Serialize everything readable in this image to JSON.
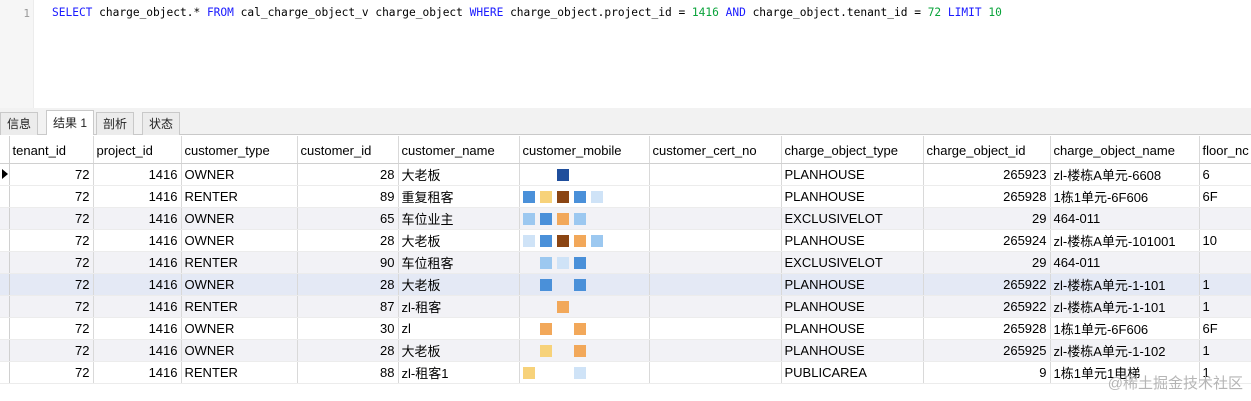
{
  "editor": {
    "line_number": "1",
    "sql_parts": {
      "select": "SELECT",
      "cols": " charge_object.* ",
      "from": "FROM",
      "table": " cal_charge_object_v charge_object ",
      "where": "WHERE",
      "cond1": " charge_object.project_id = ",
      "val1": "1416",
      "and": " AND",
      "cond2": " charge_object.tenant_id = ",
      "val2": "72",
      "limit": " LIMIT ",
      "val3": "10"
    }
  },
  "tabs": [
    {
      "label": "信息"
    },
    {
      "label": "结果 1"
    },
    {
      "label": "剖析"
    },
    {
      "label": "状态"
    }
  ],
  "columns": [
    "tenant_id",
    "project_id",
    "customer_type",
    "customer_id",
    "customer_name",
    "customer_mobile",
    "customer_cert_no",
    "charge_object_type",
    "charge_object_id",
    "charge_object_name",
    "floor_nc"
  ],
  "rows": [
    {
      "tenant_id": "72",
      "project_id": "1416",
      "customer_type": "OWNER",
      "customer_id": "28",
      "customer_name": "大老板",
      "charge_object_type": "PLANHOUSE",
      "charge_object_id": "265923",
      "charge_object_name": "zl-楼栋A单元-6608",
      "floor_no": "6"
    },
    {
      "tenant_id": "72",
      "project_id": "1416",
      "customer_type": "RENTER",
      "customer_id": "89",
      "customer_name": "重复租客",
      "charge_object_type": "PLANHOUSE",
      "charge_object_id": "265928",
      "charge_object_name": "1栋1单元-6F606",
      "floor_no": "6F"
    },
    {
      "tenant_id": "72",
      "project_id": "1416",
      "customer_type": "OWNER",
      "customer_id": "65",
      "customer_name": "车位业主",
      "charge_object_type": "EXCLUSIVELOT",
      "charge_object_id": "29",
      "charge_object_name": "464-011",
      "floor_no": ""
    },
    {
      "tenant_id": "72",
      "project_id": "1416",
      "customer_type": "OWNER",
      "customer_id": "28",
      "customer_name": "大老板",
      "charge_object_type": "PLANHOUSE",
      "charge_object_id": "265924",
      "charge_object_name": "zl-楼栋A单元-101001",
      "floor_no": "10"
    },
    {
      "tenant_id": "72",
      "project_id": "1416",
      "customer_type": "RENTER",
      "customer_id": "90",
      "customer_name": "车位租客",
      "charge_object_type": "EXCLUSIVELOT",
      "charge_object_id": "29",
      "charge_object_name": "464-011",
      "floor_no": ""
    },
    {
      "tenant_id": "72",
      "project_id": "1416",
      "customer_type": "OWNER",
      "customer_id": "28",
      "customer_name": "大老板",
      "charge_object_type": "PLANHOUSE",
      "charge_object_id": "265922",
      "charge_object_name": "zl-楼栋A单元-1-101",
      "floor_no": "1"
    },
    {
      "tenant_id": "72",
      "project_id": "1416",
      "customer_type": "RENTER",
      "customer_id": "87",
      "customer_name": "zl-租客",
      "charge_object_type": "PLANHOUSE",
      "charge_object_id": "265922",
      "charge_object_name": "zl-楼栋A单元-1-101",
      "floor_no": "1"
    },
    {
      "tenant_id": "72",
      "project_id": "1416",
      "customer_type": "OWNER",
      "customer_id": "30",
      "customer_name": "zl",
      "charge_object_type": "PLANHOUSE",
      "charge_object_id": "265928",
      "charge_object_name": "1栋1单元-6F606",
      "floor_no": "6F"
    },
    {
      "tenant_id": "72",
      "project_id": "1416",
      "customer_type": "OWNER",
      "customer_id": "28",
      "customer_name": "大老板",
      "charge_object_type": "PLANHOUSE",
      "charge_object_id": "265925",
      "charge_object_name": "zl-楼栋A单元-1-102",
      "floor_no": "1"
    },
    {
      "tenant_id": "72",
      "project_id": "1416",
      "customer_type": "RENTER",
      "customer_id": "88",
      "customer_name": "zl-租客1",
      "charge_object_type": "PUBLICAREA",
      "charge_object_id": "9",
      "charge_object_name": "1栋1单元1电梯",
      "floor_no": "1"
    }
  ],
  "mosaic_colors": [
    "#4a90d9",
    "#9cc8f0",
    "#f2a85a",
    "#8b4513",
    "#1f4e9c",
    "#f7d27a",
    "#cfe3f7"
  ],
  "watermark": "@稀土掘金技术社区"
}
